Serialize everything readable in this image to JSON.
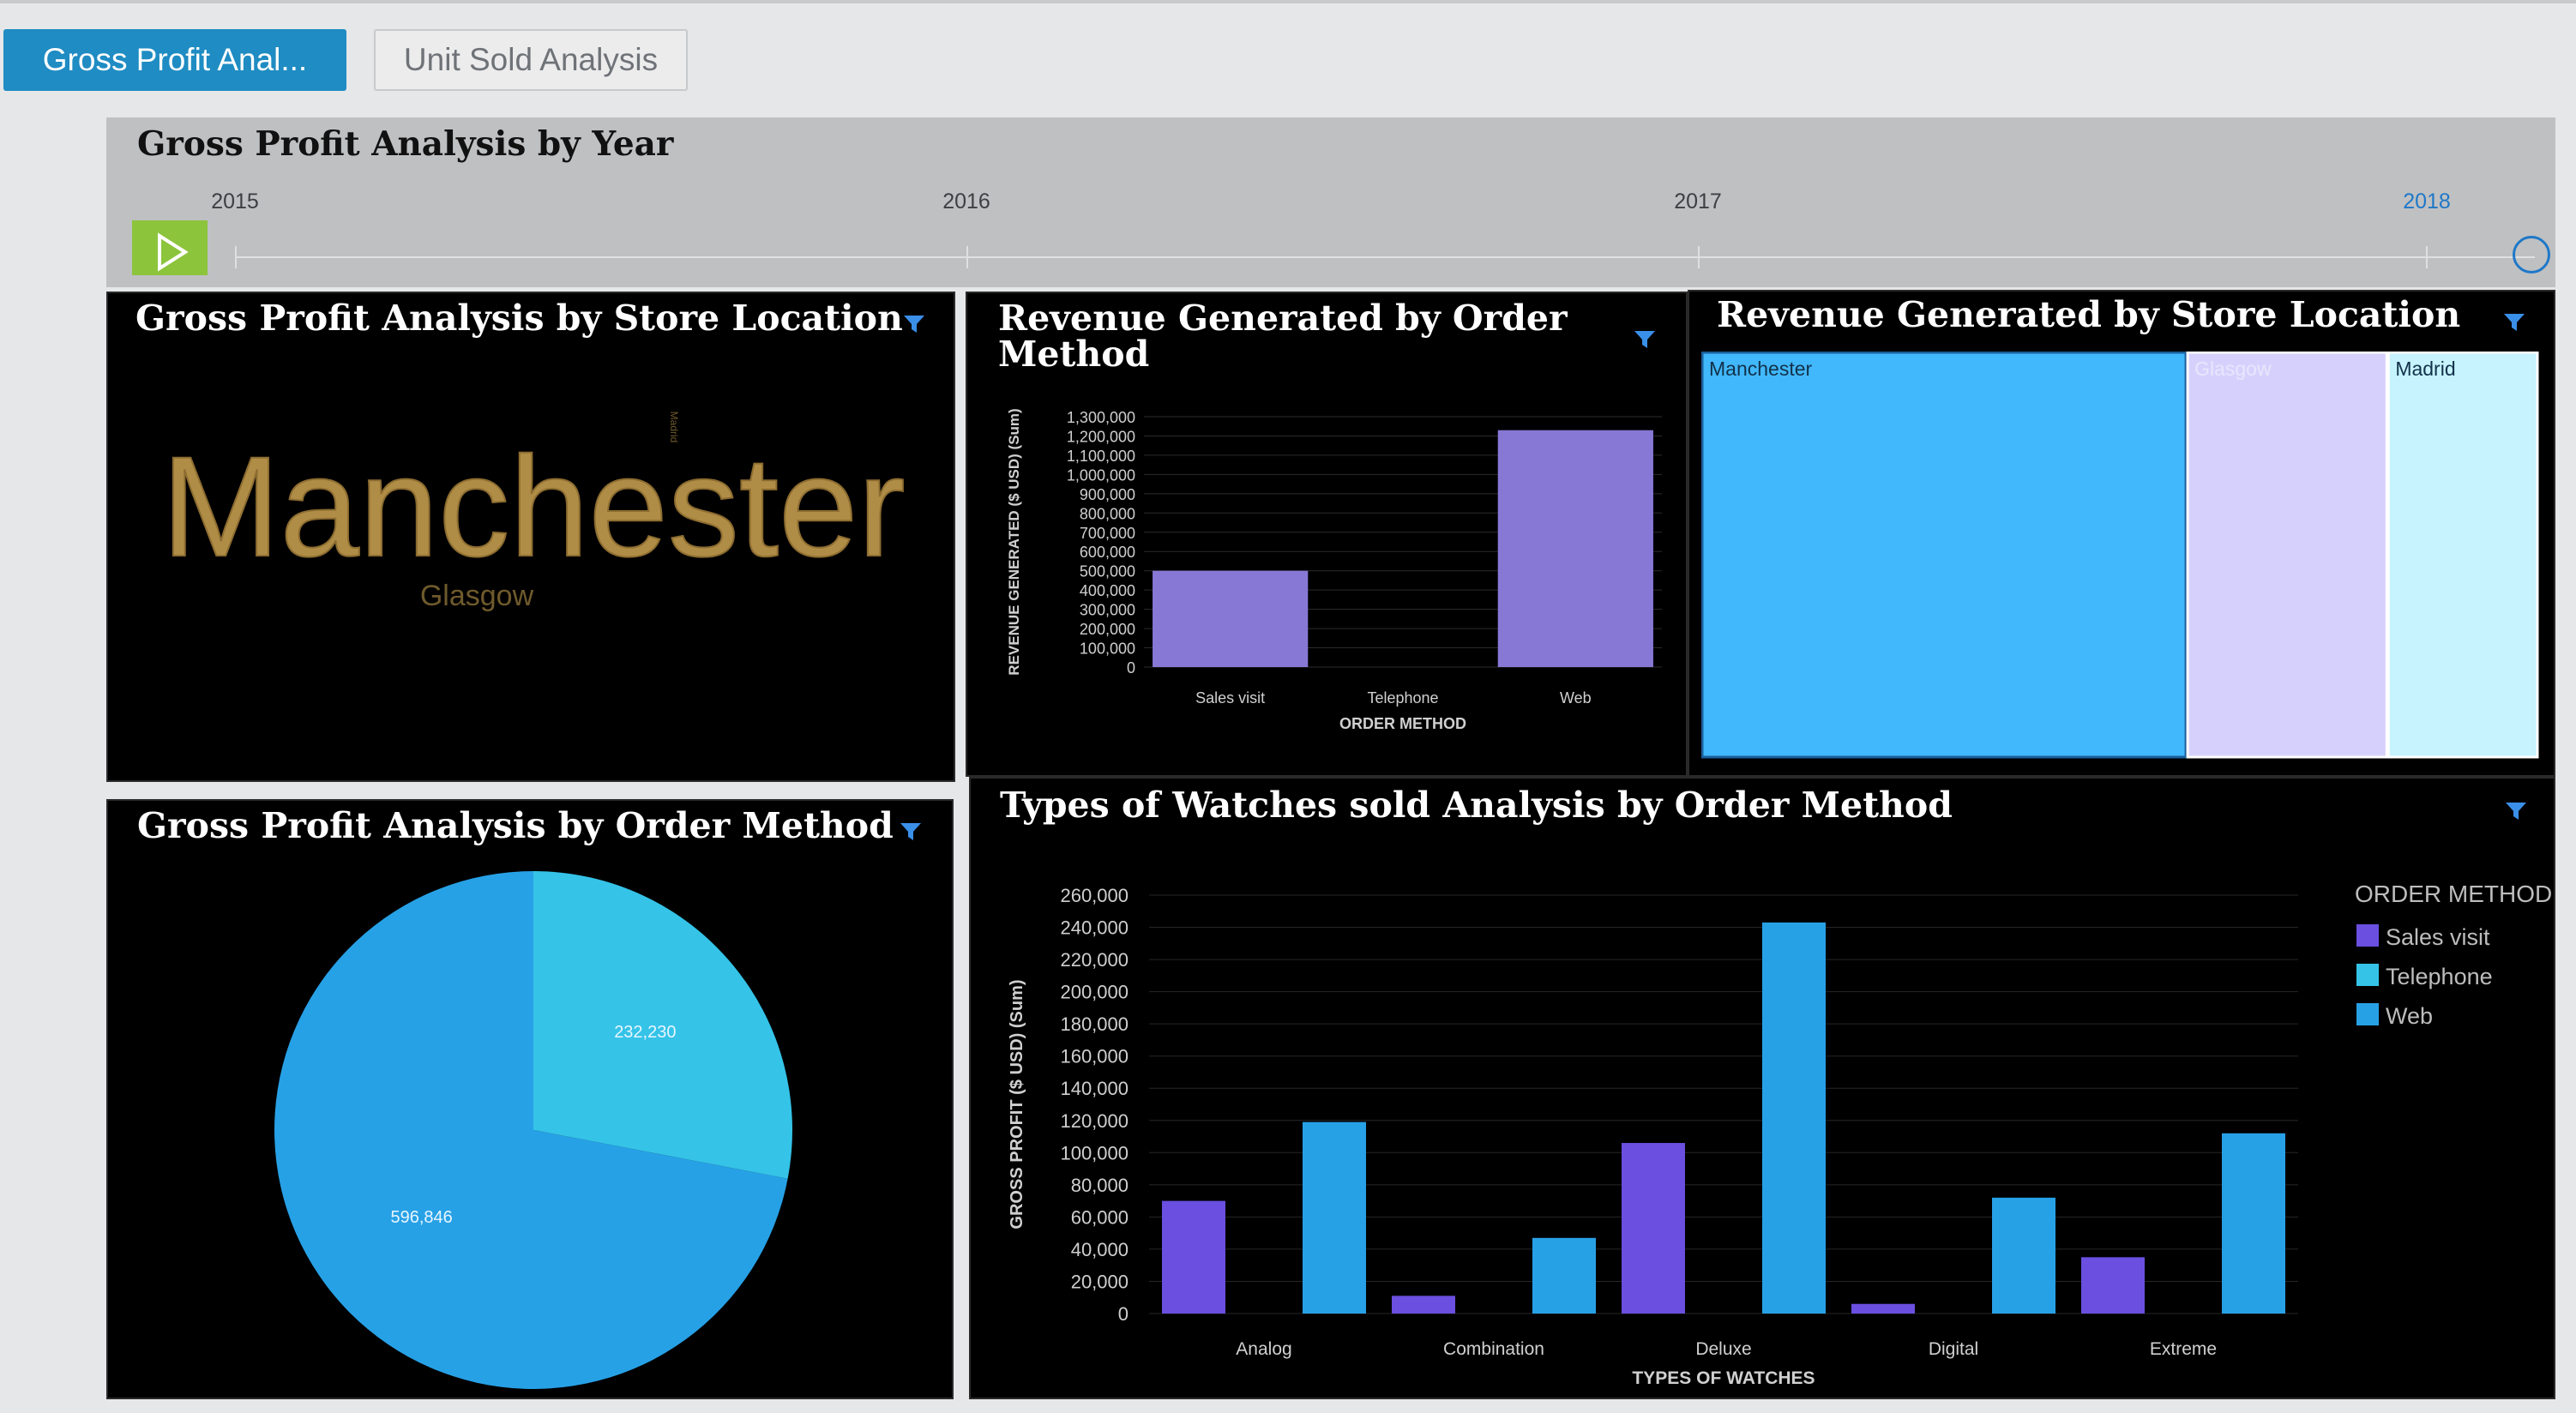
{
  "tabs": [
    {
      "label": "Gross Profit Anal..."
    },
    {
      "label": "Unit Sold Analysis"
    }
  ],
  "year_panel": {
    "title": "Gross Profit Analysis by Year",
    "years": [
      "2015",
      "2016",
      "2017",
      "2018"
    ],
    "selected_year": "2018"
  },
  "panels": {
    "store_wordcloud": {
      "title": "Gross Profit Analysis by Store Location",
      "words": [
        {
          "text": "Manchester",
          "color": "#b08d46"
        },
        {
          "text": "Glasgow",
          "color": "#6f5a2c"
        },
        {
          "text": "Madrid",
          "color": "#6f5a2c"
        }
      ]
    },
    "revenue_order": {
      "title": "Revenue Generated by Order Method"
    },
    "revenue_store": {
      "title": "Revenue Generated by Store Location"
    },
    "profit_order_pie": {
      "title": "Gross Profit Analysis by Order Method"
    },
    "watches": {
      "title": "Types of Watches sold Analysis by Order Method"
    }
  },
  "colors": {
    "accent": "#1f8cc3",
    "play_button": "#8cc43c",
    "sales_visit": "#6a4fe0",
    "telephone": "#35c3e8",
    "web": "#27a1e6",
    "bar_purple": "#8878d6",
    "treemap_manchester": "#41b8fb",
    "treemap_glasgow": "#d6d1fc",
    "treemap_madrid": "#c6f3fd"
  },
  "icons": {
    "filter": "funnel-icon",
    "play": "play-icon"
  },
  "chart_data": [
    {
      "id": "revenue_by_order_method",
      "type": "bar",
      "categories": [
        "Sales visit",
        "Telephone",
        "Web"
      ],
      "values": [
        500000,
        0,
        1230000
      ],
      "xlabel": "ORDER METHOD",
      "ylabel": "REVENUE GENERATED ($ USD) (Sum)",
      "ylim": [
        0,
        1300000
      ],
      "yticks": [
        0,
        100000,
        200000,
        300000,
        400000,
        500000,
        600000,
        700000,
        800000,
        900000,
        1000000,
        1100000,
        1200000,
        1300000
      ],
      "ytick_labels": [
        "0",
        "100,000",
        "200,000",
        "300,000",
        "400,000",
        "500,000",
        "600,000",
        "700,000",
        "800,000",
        "900,000",
        "1,000,000",
        "1,100,000",
        "1,200,000",
        "1,300,000"
      ],
      "grid": true
    },
    {
      "id": "revenue_by_store_location",
      "type": "treemap",
      "categories": [
        "Manchester",
        "Glasgow",
        "Madrid"
      ],
      "values": [
        58,
        24,
        18
      ]
    },
    {
      "id": "gross_profit_by_order_method",
      "type": "pie",
      "categories": [
        "Telephone",
        "Web"
      ],
      "values": [
        232230,
        596846
      ],
      "value_labels": [
        "232,230",
        "596,846"
      ]
    },
    {
      "id": "watches_by_order_method",
      "type": "bar",
      "categories": [
        "Analog",
        "Combination",
        "Deluxe",
        "Digital",
        "Extreme"
      ],
      "series": [
        {
          "name": "Sales visit",
          "values": [
            70000,
            11000,
            106000,
            6000,
            35000
          ]
        },
        {
          "name": "Web",
          "values": [
            119000,
            47000,
            243000,
            72000,
            112000
          ]
        }
      ],
      "legend": {
        "title": "ORDER METHOD",
        "entries": [
          "Sales visit",
          "Telephone",
          "Web"
        ],
        "placement": "top-right"
      },
      "xlabel": "TYPES OF WATCHES",
      "ylabel": "GROSS PROFIT ($ USD) (Sum)",
      "ylim": [
        0,
        260000
      ],
      "yticks": [
        0,
        20000,
        40000,
        60000,
        80000,
        100000,
        120000,
        140000,
        160000,
        180000,
        200000,
        220000,
        240000,
        260000
      ],
      "ytick_labels": [
        "0",
        "20,000",
        "40,000",
        "60,000",
        "80,000",
        "100,000",
        "120,000",
        "140,000",
        "160,000",
        "180,000",
        "200,000",
        "220,000",
        "240,000",
        "260,000"
      ],
      "grid": true
    }
  ]
}
